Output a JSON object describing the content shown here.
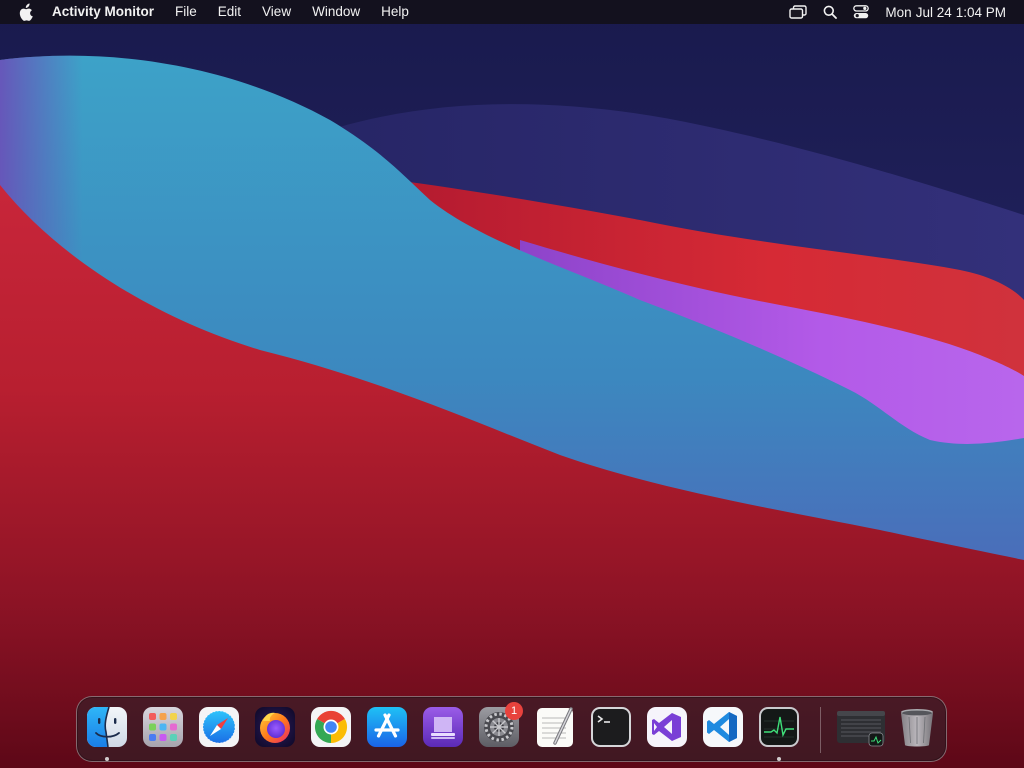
{
  "menubar": {
    "app_name": "Activity Monitor",
    "menus": [
      "File",
      "Edit",
      "View",
      "Window",
      "Help"
    ],
    "clock": {
      "day": "Mon",
      "date": "Jul 24",
      "time": "1:04 PM"
    }
  },
  "dock": {
    "items": [
      {
        "name": "finder",
        "running": true
      },
      {
        "name": "launchpad",
        "running": false
      },
      {
        "name": "safari",
        "running": false
      },
      {
        "name": "firefox",
        "running": false
      },
      {
        "name": "chrome",
        "running": false
      },
      {
        "name": "app-store",
        "running": false
      },
      {
        "name": "apple-configurator",
        "running": false
      },
      {
        "name": "system-preferences",
        "running": false,
        "badge": "1"
      },
      {
        "name": "textedit",
        "running": false
      },
      {
        "name": "terminal",
        "running": false
      },
      {
        "name": "visual-studio",
        "running": false
      },
      {
        "name": "vscode",
        "running": false
      },
      {
        "name": "activity-monitor",
        "running": true
      },
      {
        "name": "minimized-window",
        "running": false
      },
      {
        "name": "trash",
        "running": false
      }
    ]
  },
  "colors": {
    "sky": "#1e1f5c",
    "blue_wave": "#3b9cc4",
    "red_wave": "#d42a38",
    "violet_wave": "#b657e6",
    "deep_red": "#6a0a1a",
    "badge": "#e8423d"
  }
}
